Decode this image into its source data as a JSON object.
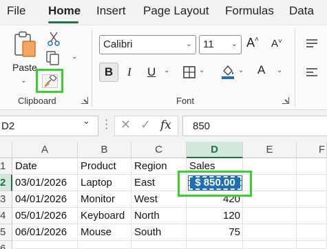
{
  "tabs": [
    "File",
    "Home",
    "Insert",
    "Page Layout",
    "Formulas",
    "Data"
  ],
  "active_tab": "Home",
  "ribbon": {
    "clipboard": {
      "label": "Clipboard",
      "paste_label": "Paste"
    },
    "font": {
      "label": "Font",
      "font_name": "Calibri",
      "font_size": "11",
      "bold": "B",
      "italic": "I",
      "underline": "U",
      "font_color_letter": "A",
      "grow_font": "A",
      "shrink_font": "A"
    },
    "highlight_color": "#3ad12e",
    "accent_color": "#1e7145"
  },
  "formula_bar": {
    "name_box": "D2",
    "fx": "fx",
    "value": "850"
  },
  "sheet": {
    "columns": [
      "A",
      "B",
      "C",
      "D",
      "E",
      "F"
    ],
    "rows": [
      "1",
      "2",
      "3",
      "4",
      "5",
      "6"
    ],
    "selected_column": "D",
    "selected_row": "2",
    "cells": [
      [
        "Date",
        "Product",
        "Region",
        "Sales"
      ],
      [
        "03/01/2026",
        "Laptop",
        "East",
        "$ 850.00"
      ],
      [
        "04/01/2026",
        "Monitor",
        "West",
        "420"
      ],
      [
        "05/01/2026",
        "Keyboard",
        "North",
        "120"
      ],
      [
        "06/01/2026",
        "Mouse",
        "South",
        "75"
      ]
    ],
    "active_cell_color": "#1f6fb5"
  }
}
